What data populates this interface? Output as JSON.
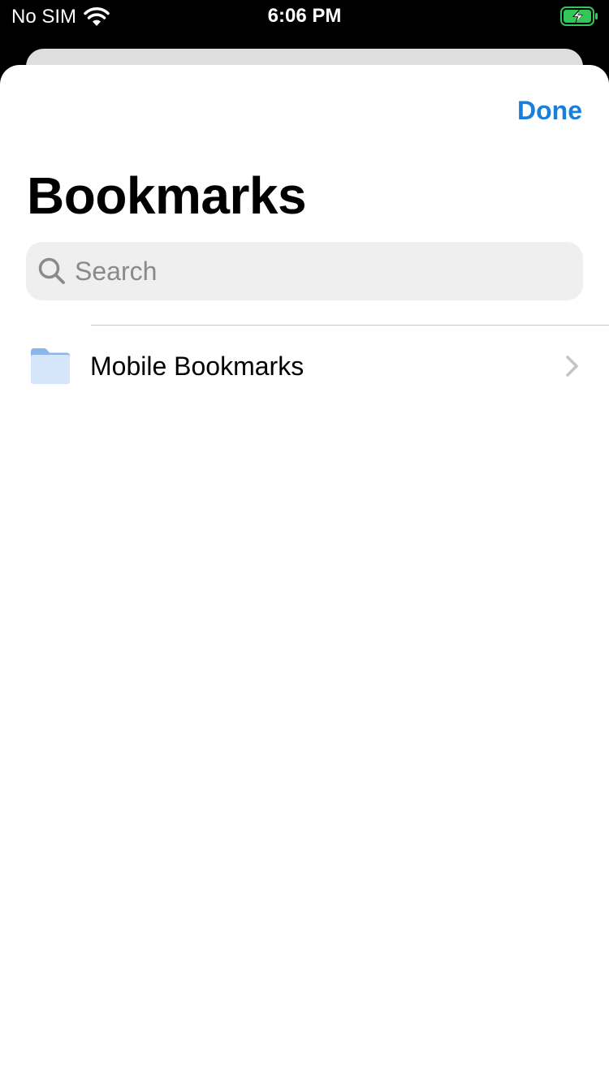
{
  "status_bar": {
    "carrier": "No SIM",
    "time": "6:06 PM",
    "wifi_icon": "wifi-icon",
    "battery_icon": "battery-charging-icon",
    "battery_color": "#32c759"
  },
  "sheet": {
    "done_label": "Done",
    "title": "Bookmarks",
    "accent_color": "#1a7fdb"
  },
  "search": {
    "placeholder": "Search",
    "value": "",
    "icon": "search-icon"
  },
  "list": {
    "items": [
      {
        "label": "Mobile Bookmarks",
        "icon": "folder-icon",
        "accessory": "chevron-right-icon"
      }
    ]
  }
}
